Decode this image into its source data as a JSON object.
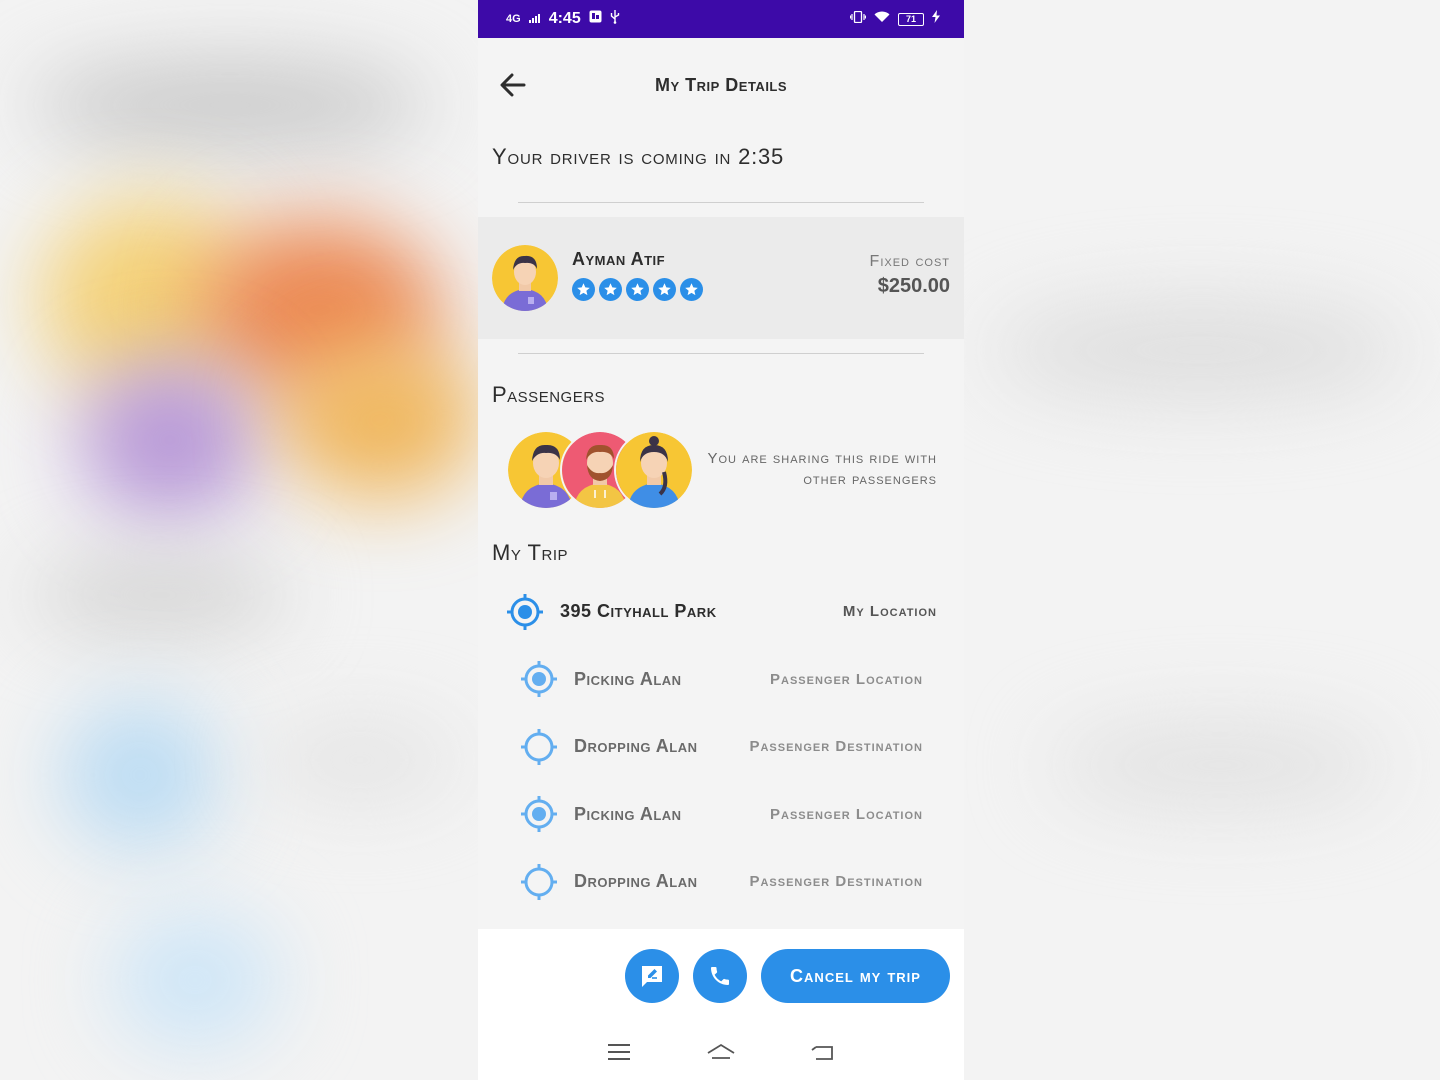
{
  "status_bar": {
    "network": "4G",
    "time": "4:45",
    "battery": "71"
  },
  "header": {
    "title": "My Trip Details"
  },
  "eta": {
    "text": "Your driver is coming in 2:35"
  },
  "driver": {
    "name": "Ayman Atif",
    "rating": 5,
    "cost_label": "Fixed cost",
    "cost_value": "$250.00"
  },
  "passengers": {
    "title": "Passengers",
    "share_text": "You are sharing this ride with other passengers"
  },
  "trip": {
    "title": "My Trip",
    "stops": [
      {
        "place": "395 Cityhall Park",
        "tag": "My Location"
      },
      {
        "place": "Picking Alan",
        "tag": "Passenger Location"
      },
      {
        "place": "Dropping Alan",
        "tag": "Passenger Destination"
      },
      {
        "place": "Picking Alan",
        "tag": "Passenger Location"
      },
      {
        "place": "Dropping Alan",
        "tag": "Passenger Destination"
      }
    ]
  },
  "actions": {
    "cancel_label": "Cancel my trip"
  },
  "colors": {
    "accent": "#2b8fe8",
    "status_bar": "#3d0aa8"
  }
}
